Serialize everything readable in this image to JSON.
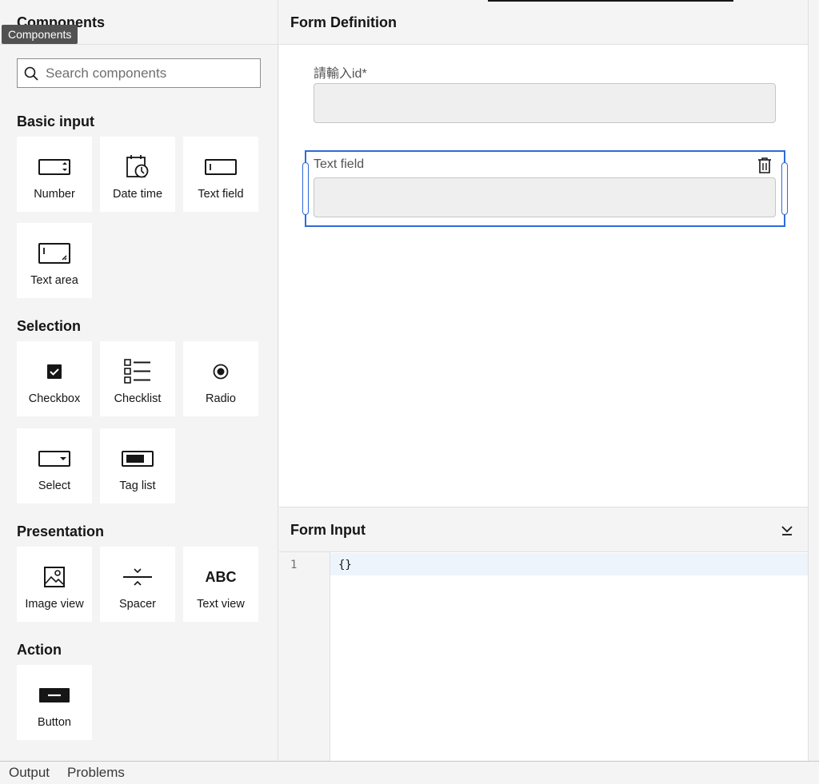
{
  "palette": {
    "title": "Components",
    "tooltip": "Components",
    "search_placeholder": "Search components",
    "groups": [
      {
        "title": "Basic input",
        "items": [
          "Number",
          "Date time",
          "Text field",
          "Text area"
        ]
      },
      {
        "title": "Selection",
        "items": [
          "Checkbox",
          "Checklist",
          "Radio",
          "Select",
          "Tag list"
        ]
      },
      {
        "title": "Presentation",
        "items": [
          "Image view",
          "Spacer",
          "Text view"
        ]
      },
      {
        "title": "Action",
        "items": [
          "Button"
        ]
      }
    ],
    "text_view_glyph": "ABC"
  },
  "form_definition": {
    "title": "Form Definition",
    "fields": [
      {
        "label": "請輸入id*",
        "value": ""
      },
      {
        "label": "Text field",
        "value": ""
      }
    ]
  },
  "form_input": {
    "title": "Form Input",
    "line_number": "1",
    "code": "{}"
  },
  "bottom_tabs": [
    "Output",
    "Problems"
  ],
  "colors": {
    "accent": "#2f6ad8",
    "panel": "#f4f4f4",
    "input_bg": "#efefef"
  }
}
